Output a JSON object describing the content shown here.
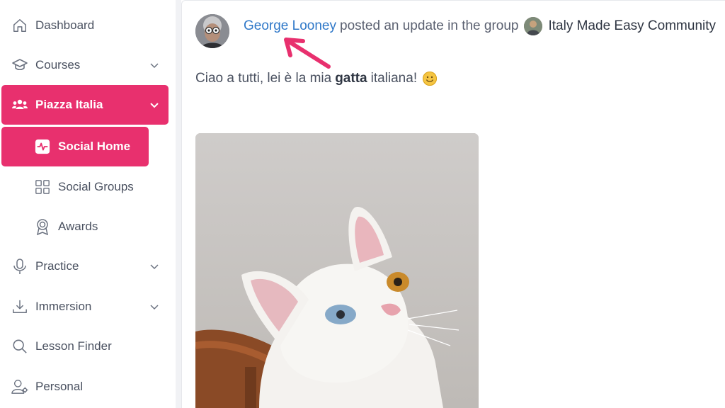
{
  "sidebar": {
    "items": [
      {
        "label": "Dashboard",
        "icon": "home-icon",
        "has_chevron": false
      },
      {
        "label": "Courses",
        "icon": "graduation-cap-icon",
        "has_chevron": true
      },
      {
        "label": "Piazza Italia",
        "icon": "users-icon",
        "has_chevron": true,
        "active": true
      },
      {
        "label": "Social Home",
        "icon": "activity-icon",
        "has_chevron": false,
        "active": true,
        "sub": true
      },
      {
        "label": "Social Groups",
        "icon": "grid-icon",
        "has_chevron": false,
        "sub": true
      },
      {
        "label": "Awards",
        "icon": "award-icon",
        "has_chevron": false,
        "sub": true
      },
      {
        "label": "Practice",
        "icon": "microphone-icon",
        "has_chevron": true
      },
      {
        "label": "Immersion",
        "icon": "download-icon",
        "has_chevron": true
      },
      {
        "label": "Lesson Finder",
        "icon": "search-icon",
        "has_chevron": false
      },
      {
        "label": "Personal",
        "icon": "user-settings-icon",
        "has_chevron": false
      }
    ]
  },
  "post": {
    "author": "George Looney",
    "action": "posted an update in the group",
    "group": "Italy Made Easy Community",
    "text_before": "Ciao a tutti, lei è la mia",
    "text_bold": "gatta",
    "text_after": "italiana!",
    "emoji": "slightly-smiling-face"
  },
  "colors": {
    "accent": "#e8306e",
    "link": "#2f78c8",
    "annotation_arrow": "#e8306e"
  }
}
